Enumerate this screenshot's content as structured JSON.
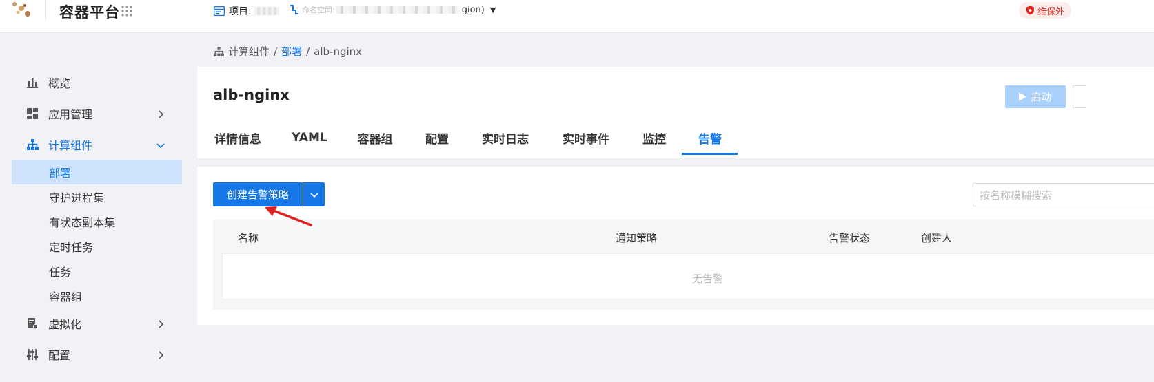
{
  "header": {
    "app_title": "容器平台",
    "project_label": "项目:",
    "namespace_label": "命名空间:",
    "namespace_suffix": "gion)",
    "maintenance_badge": "维保外"
  },
  "sidebar": {
    "items": [
      {
        "label": "概览",
        "icon": "bar-chart-icon"
      },
      {
        "label": "应用管理",
        "icon": "apps-icon"
      },
      {
        "label": "计算组件",
        "icon": "hierarchy-icon"
      },
      {
        "label": "虚拟化",
        "icon": "virtual-icon"
      },
      {
        "label": "配置",
        "icon": "sliders-icon"
      }
    ],
    "sub_items": [
      {
        "label": "部署"
      },
      {
        "label": "守护进程集"
      },
      {
        "label": "有状态副本集"
      },
      {
        "label": "定时任务"
      },
      {
        "label": "任务"
      },
      {
        "label": "容器组"
      }
    ]
  },
  "breadcrumb": {
    "root": "计算组件",
    "sep1": "/",
    "link": "部署",
    "sep2": "/",
    "current": "alb-nginx"
  },
  "page": {
    "title": "alb-nginx",
    "start_button": "启动"
  },
  "tabs": [
    {
      "label": "详情信息"
    },
    {
      "label": "YAML"
    },
    {
      "label": "容器组"
    },
    {
      "label": "配置"
    },
    {
      "label": "实时日志"
    },
    {
      "label": "实时事件"
    },
    {
      "label": "监控"
    },
    {
      "label": "告警"
    }
  ],
  "alerts": {
    "create_button": "创建告警策略",
    "search_placeholder": "按名称模糊搜索",
    "columns": [
      "名称",
      "通知策略",
      "告警状态",
      "创建人"
    ],
    "empty_text": "无告警"
  },
  "colors": {
    "accent": "#1677e6",
    "active_bg": "#cde3fb",
    "badge_red": "#e1251b",
    "annotation_arrow": "#e02020"
  }
}
